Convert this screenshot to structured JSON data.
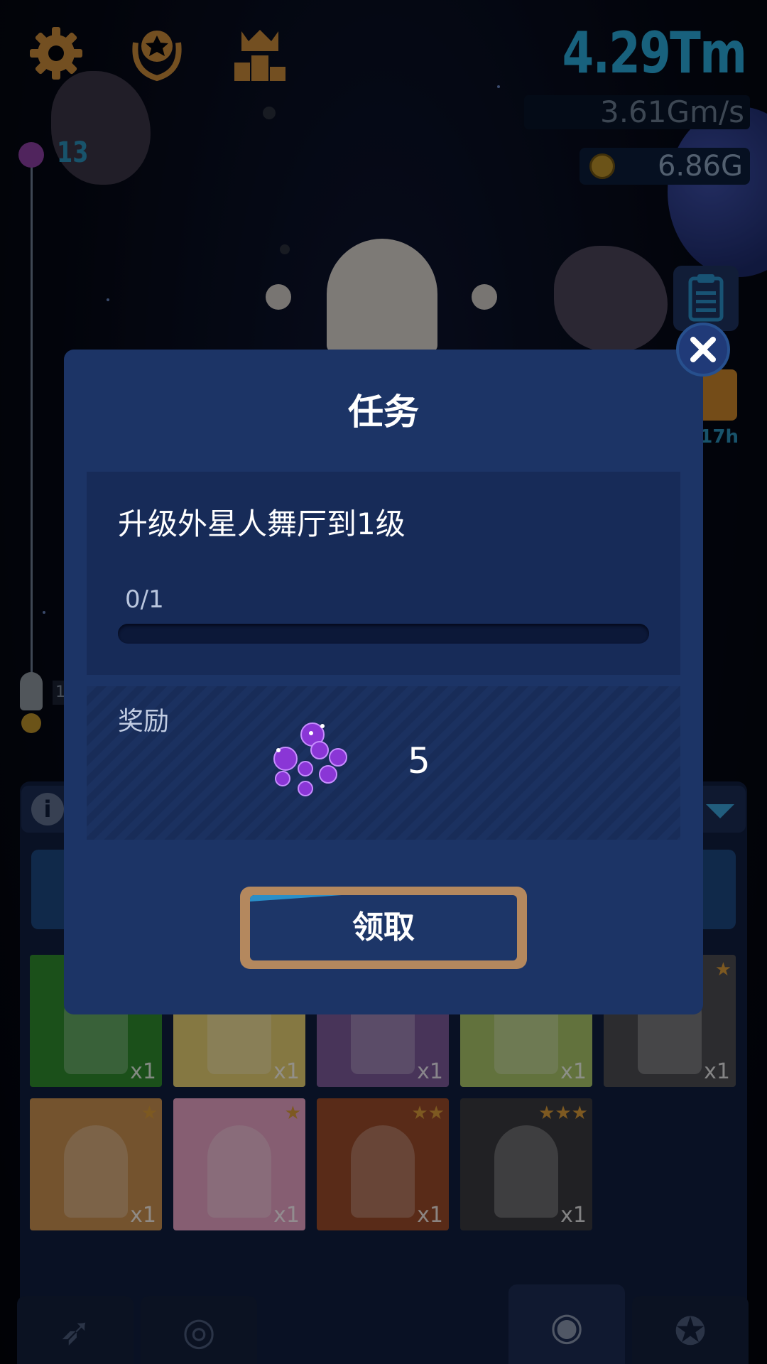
{
  "hud": {
    "settings_icon": "gear-icon",
    "achievements_icon": "trophy-icon",
    "leaderboard_icon": "podium-icon",
    "money_total": "4.29Tm",
    "money_rate": "3.61Gm/s",
    "coins": "6.86G",
    "level": "13",
    "gift_timer": "17h",
    "rocket_marker_label": "1"
  },
  "collection": {
    "cards": [
      {
        "qty": "x1",
        "stars": "",
        "color": "#2f8a2e"
      },
      {
        "qty": "x1",
        "stars": "",
        "color": "#e6cf73"
      },
      {
        "qty": "x1",
        "stars": "",
        "color": "#7c5a9a"
      },
      {
        "qty": "x1",
        "stars": "",
        "color": "#a9c46a"
      },
      {
        "qty": "x1",
        "stars": "★",
        "color": "#4c4c52"
      },
      {
        "qty": "x1",
        "stars": "★",
        "color": "#c98f50"
      },
      {
        "qty": "x1",
        "stars": "★",
        "color": "#e7a3c4"
      },
      {
        "qty": "x1",
        "stars": "★★",
        "color": "#9a4a2a"
      },
      {
        "qty": "x1",
        "stars": "★★★",
        "color": "#3a3a3e"
      }
    ]
  },
  "nav": {
    "items": [
      {
        "icon": "rocket-icon"
      },
      {
        "icon": "target-icon"
      },
      {
        "icon": "observatory-icon",
        "active": true
      },
      {
        "icon": "badge-icon"
      }
    ]
  },
  "modal": {
    "title": "任务",
    "task_description": "升级外星人舞厅到1级",
    "task_progress": "0/1",
    "task_progress_fraction": 0,
    "reward_label": "奖励",
    "reward_icon": "gems-icon",
    "reward_amount": "5",
    "claim_label": "领取",
    "close_icon": "close-icon"
  },
  "colors": {
    "modal_bg": "#1c3466",
    "accent_blue": "#2aa8d8",
    "claim_border": "#b4885e"
  }
}
